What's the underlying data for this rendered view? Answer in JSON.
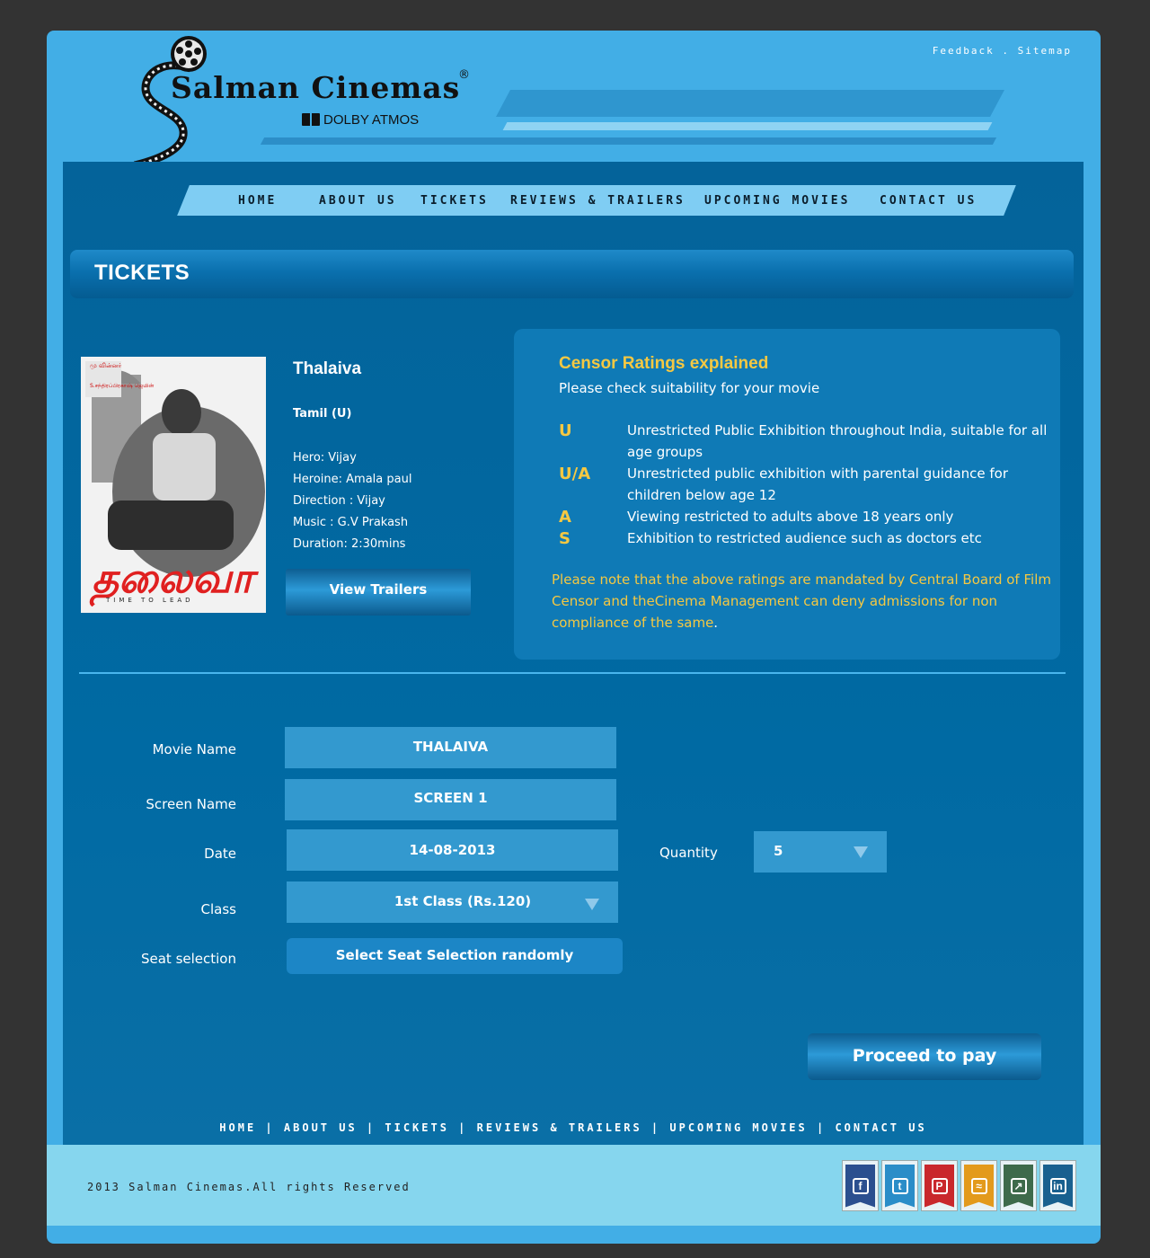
{
  "header": {
    "top_links": [
      "Feedback",
      "Sitemap"
    ],
    "top_links_separator": " . ",
    "logo_text": "Salman Cinemas",
    "logo_reg": "®",
    "logo_sub": "DOLBY ATMOS"
  },
  "nav": [
    "HOME",
    "ABOUT US",
    "TICKETS",
    "REVIEWS & TRAILERS",
    "UPCOMING MOVIES",
    "CONTACT US"
  ],
  "page_title": "TICKETS",
  "movie": {
    "title": "Thalaiva",
    "language": "Tamil (U)",
    "hero": "Hero: Vijay",
    "heroine": "Heroine: Amala paul",
    "direction": "Direction : Vijay",
    "music": "Music : G.V Prakash",
    "duration": "Duration: 2:30mins",
    "trailers_label": "View Trailers",
    "poster_tagline": "TIME TO LEAD"
  },
  "censor": {
    "title": "Censor Ratings explained",
    "subtitle": "Please check suitability for your movie",
    "ratings": [
      {
        "code": "U",
        "desc": "Unrestricted Public Exhibition throughout India, suitable for all age groups"
      },
      {
        "code": "U/A",
        "desc": "Unrestricted public exhibition with parental guidance for children below age 12"
      },
      {
        "code": "A",
        "desc": "Viewing restricted to adults above 18 years only"
      },
      {
        "code": "S",
        "desc": "Exhibition to restricted audience such as doctors etc"
      }
    ],
    "note": "Please note that the above ratings are mandated by Central Board of Film Censor and theCinema Management can deny admissions for non compliance of the same",
    "note_end": "."
  },
  "form": {
    "movie_name_label": "Movie Name",
    "movie_name_value": "THALAIVA",
    "screen_name_label": "Screen Name",
    "screen_name_value": "SCREEN 1",
    "date_label": "Date",
    "date_value": "14-08-2013",
    "quantity_label": "Quantity",
    "quantity_value": "5",
    "class_label": "Class",
    "class_value": "1st Class (Rs.120)",
    "seat_label": "Seat selection",
    "seat_button": "Select Seat Selection randomly",
    "proceed_button": "Proceed to pay"
  },
  "footer_nav": [
    "HOME",
    "ABOUT US",
    "TICKETS",
    "REVIEWS & TRAILERS",
    "UPCOMING MOVIES",
    "CONTACT US"
  ],
  "footer_separator": " | ",
  "copyright": "2013 Salman Cinemas.All rights Reserved",
  "socials": [
    {
      "name": "facebook-icon",
      "glyph": "f",
      "color": "#2b4f8f"
    },
    {
      "name": "twitter-icon",
      "glyph": "t",
      "color": "#2a8dc8"
    },
    {
      "name": "pinterest-icon",
      "glyph": "P",
      "color": "#c9272c"
    },
    {
      "name": "rss-icon",
      "glyph": "≈",
      "color": "#e39a1c"
    },
    {
      "name": "share-icon",
      "glyph": "↗",
      "color": "#3e6a4b"
    },
    {
      "name": "linkedin-icon",
      "glyph": "in",
      "color": "#19608f"
    }
  ],
  "colors": {
    "page_bg": "#333333",
    "site_bg": "#42aee6",
    "content_bg": "#006aa3",
    "accent_yellow": "#f5c842",
    "nav_bg": "#7fcdf3",
    "footer_bg": "#86d6ee"
  }
}
